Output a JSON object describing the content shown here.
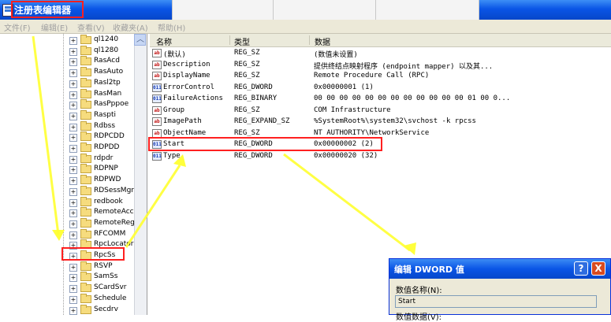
{
  "window": {
    "title": "注册表编辑器"
  },
  "menu": [
    "文件(F)",
    "编辑(E)",
    "查看(V)",
    "收藏夹(A)",
    "帮助(H)"
  ],
  "tree": {
    "items": [
      "ql1240",
      "ql1280",
      "RasAcd",
      "RasAuto",
      "Rasl2tp",
      "RasMan",
      "RasPppoe",
      "Raspti",
      "Rdbss",
      "RDPCDD",
      "RDPDD",
      "rdpdr",
      "RDPNP",
      "RDPWD",
      "RDSessMgr",
      "redbook",
      "RemoteAcce",
      "RemoteRegi",
      "RFCOMM",
      "RpcLocator",
      "RpcSs",
      "RSVP",
      "SamSs",
      "SCardSvr",
      "Schedule",
      "Secdrv"
    ]
  },
  "list": {
    "columns": [
      "名称",
      "类型",
      "数据"
    ],
    "rows": [
      {
        "icon": "ab",
        "name": "(默认)",
        "type": "REG_SZ",
        "data": "(数值未设置)"
      },
      {
        "icon": "ab",
        "name": "Description",
        "type": "REG_SZ",
        "data": "提供终结点映射程序 (endpoint mapper) 以及其..."
      },
      {
        "icon": "ab",
        "name": "DisplayName",
        "type": "REG_SZ",
        "data": "Remote Procedure Call (RPC)"
      },
      {
        "icon": "dw",
        "name": "ErrorControl",
        "type": "REG_DWORD",
        "data": "0x00000001 (1)"
      },
      {
        "icon": "dw",
        "name": "FailureActions",
        "type": "REG_BINARY",
        "data": "00 00 00 00 00 00 00 00 00 00 00 00 01 00 0..."
      },
      {
        "icon": "ab",
        "name": "Group",
        "type": "REG_SZ",
        "data": "COM Infrastructure"
      },
      {
        "icon": "ab",
        "name": "ImagePath",
        "type": "REG_EXPAND_SZ",
        "data": "%SystemRoot%\\system32\\svchost -k rpcss"
      },
      {
        "icon": "ab",
        "name": "ObjectName",
        "type": "REG_SZ",
        "data": "NT AUTHORITY\\NetworkService"
      },
      {
        "icon": "dw",
        "name": "Start",
        "type": "REG_DWORD",
        "data": "0x00000002 (2)"
      },
      {
        "icon": "dw",
        "name": "Type",
        "type": "REG_DWORD",
        "data": "0x00000020 (32)"
      }
    ]
  },
  "dialog": {
    "title": "编辑 DWORD 值",
    "value_name_label": "数值名称(N):",
    "value_name": "Start",
    "value_data_label": "数值数据(V):",
    "help_glyph": "?",
    "close_glyph": "X"
  },
  "colors": {
    "annotation_box": "#ff2020",
    "arrow": "#ffff30",
    "titlebar": "#0a55e6"
  }
}
